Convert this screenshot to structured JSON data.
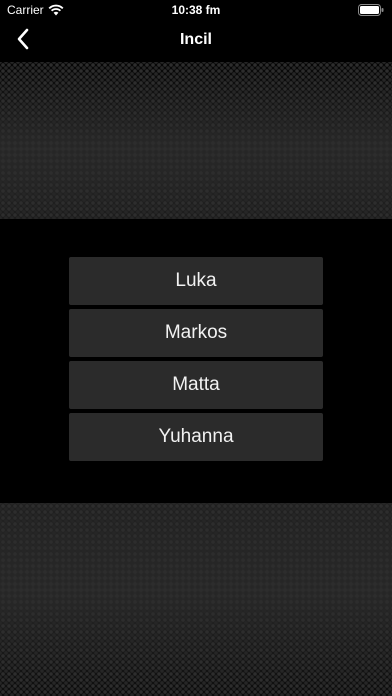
{
  "status_bar": {
    "carrier": "Carrier",
    "time": "10:38 fm"
  },
  "nav": {
    "title": "Incil",
    "back_icon": "chevron-left-icon"
  },
  "menu": {
    "items": [
      {
        "label": "Luka"
      },
      {
        "label": "Markos"
      },
      {
        "label": "Matta"
      },
      {
        "label": "Yuhanna"
      }
    ]
  },
  "colors": {
    "background": "#000000",
    "button_bg": "#2b2b2b",
    "text": "#ffffff"
  }
}
